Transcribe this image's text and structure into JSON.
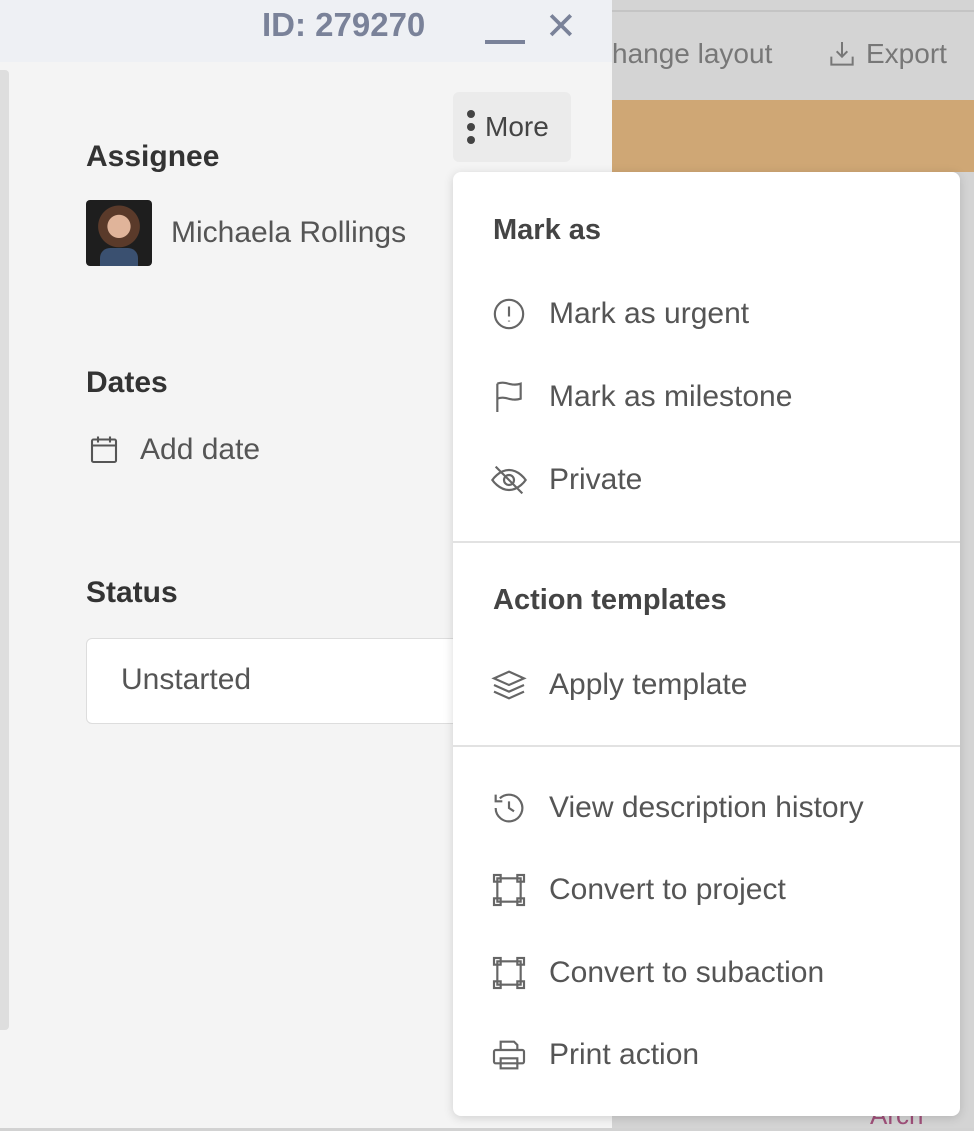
{
  "header": {
    "id_label": "ID: 279270"
  },
  "background": {
    "change_layout": "hange layout",
    "export": "Export",
    "partial_text": "Arch"
  },
  "more_button": {
    "label": "More"
  },
  "assignee": {
    "heading": "Assignee",
    "name": "Michaela Rollings"
  },
  "dates": {
    "heading": "Dates",
    "add_date": "Add date"
  },
  "status": {
    "heading": "Status",
    "value": "Unstarted"
  },
  "menu": {
    "section1": {
      "title": "Mark as",
      "items": [
        {
          "label": "Mark as urgent",
          "icon": "alert-circle-icon"
        },
        {
          "label": "Mark as milestone",
          "icon": "flag-icon"
        },
        {
          "label": "Private",
          "icon": "eye-off-icon"
        }
      ]
    },
    "section2": {
      "title": "Action templates",
      "items": [
        {
          "label": "Apply template",
          "icon": "layers-icon"
        }
      ]
    },
    "section3": {
      "items": [
        {
          "label": "View description history",
          "icon": "history-icon"
        },
        {
          "label": "Convert to project",
          "icon": "frame-icon"
        },
        {
          "label": "Convert to subaction",
          "icon": "frame-icon"
        },
        {
          "label": "Print action",
          "icon": "printer-icon"
        }
      ]
    }
  }
}
